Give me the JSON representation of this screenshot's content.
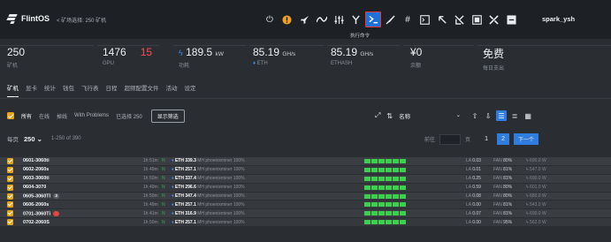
{
  "app": {
    "brand": "FlintOS",
    "back_label": "< 矿场选择: 250 矿机",
    "user": "spark_ysh",
    "tooltip": "执行命令",
    "toolbar_icons": [
      "power-icon",
      "alert-circle-icon",
      "rocket-icon",
      "waveform-icon",
      "sliders-icon",
      "wrench-icon",
      "terminal-icon",
      "brush-icon",
      "hash-icon",
      "terminal-square-icon",
      "arrow-up-left-icon",
      "wrench-cross-icon",
      "screen-icon",
      "tools-icon",
      "minus-square-icon"
    ],
    "colors": {
      "accent": "#2f7de1",
      "warning": "#e8a317",
      "ok": "#3fcf4f",
      "danger": "#ff4d57"
    }
  },
  "stats": {
    "miners": {
      "value": "250",
      "label": "矿机"
    },
    "gpu": {
      "value": "1476",
      "bad": "15",
      "label": "GPU"
    },
    "power": {
      "value": "189.5",
      "unit": "kW",
      "label": "功耗",
      "icon": "bolt-icon"
    },
    "hashrate": {
      "value": "85.19",
      "unit": "GH/s",
      "label": "ETH",
      "icon": "eth-icon"
    },
    "ethash": {
      "value": "85.19",
      "unit": "GH/s",
      "label": "ETHASH"
    },
    "balance": {
      "value": "¥0",
      "label": "余额"
    },
    "plan": {
      "value": "免费",
      "label": "每日支出"
    }
  },
  "tabs": [
    "矿机",
    "显卡",
    "统计",
    "钱包",
    "飞行表",
    "日程",
    "超频配置文件",
    "活动",
    "设定"
  ],
  "filters": {
    "items": [
      "所有",
      "在线",
      "掉线",
      "With Problems",
      "已选择 250"
    ],
    "show_filter_button": "显示筛选",
    "sort_label": "名称"
  },
  "pagination": {
    "per_page_label": "每页",
    "per_page_value": "250",
    "range": "1-250 of 390",
    "goto_label": "前往",
    "page_suffix": "页",
    "pages": [
      "1",
      "2"
    ],
    "next": "下一个"
  },
  "rows": [
    {
      "name": "0601-3060ti",
      "badge": "",
      "badge_type": "",
      "time": "1h 51m",
      "status": "N",
      "eth": "ETH 339.3",
      "unit": "MH",
      "miner": "phoenixminer",
      "pct": "100%",
      "la": "0.03",
      "fan": "80%",
      "power": "690.0 W"
    },
    {
      "name": "0602-2060s",
      "badge": "",
      "badge_type": "",
      "time": "1h 49m",
      "status": "N",
      "eth": "ETH 257.1",
      "unit": "MH",
      "miner": "phoenixminer",
      "pct": "100%",
      "la": "0.01",
      "fan": "81%",
      "power": "547.0 W"
    },
    {
      "name": "0603-3060ti",
      "badge": "",
      "badge_type": "",
      "time": "1h 50m",
      "status": "N",
      "eth": "ETH 337.4",
      "unit": "MH",
      "miner": "phoenixminer",
      "pct": "100%",
      "la": "0.25",
      "fan": "81%",
      "power": "690.0 W"
    },
    {
      "name": "0604-3070",
      "badge": "",
      "badge_type": "",
      "time": "1h 49m",
      "status": "N",
      "eth": "ETH 296.6",
      "unit": "MH",
      "miner": "phoenixminer",
      "pct": "100%",
      "la": "0.59",
      "fan": "80%",
      "power": "601.0 W"
    },
    {
      "name": "0605-3060TI",
      "badge": "2",
      "badge_type": "gray",
      "time": "1h 50m",
      "status": "N",
      "eth": "ETH 347.4",
      "unit": "MH",
      "miner": "phoenixminer",
      "pct": "100%",
      "la": "0.08",
      "fan": "80%",
      "power": "680.0 W"
    },
    {
      "name": "0606-2060s",
      "badge": "",
      "badge_type": "",
      "time": "1h 49m",
      "status": "N",
      "eth": "ETH 257.1",
      "unit": "MH",
      "miner": "phoenixminer",
      "pct": "100%",
      "la": "0.00",
      "fan": "81%",
      "power": "543.0 W"
    },
    {
      "name": "0701-3060Ti",
      "badge": "1",
      "badge_type": "red",
      "time": "1h 41m",
      "status": "N",
      "eth": "ETH 316.9",
      "unit": "MH",
      "miner": "phoenixminer",
      "pct": "100%",
      "la": "0.07",
      "fan": "81%",
      "power": "690.0 W"
    },
    {
      "name": "0702-2060S",
      "badge": "",
      "badge_type": "",
      "time": "1h 50m",
      "status": "N",
      "eth": "ETH 257.1",
      "unit": "MH",
      "miner": "phoenixminer",
      "pct": "100%",
      "la": "0.00",
      "fan": "95%",
      "power": "562.0 W"
    }
  ]
}
